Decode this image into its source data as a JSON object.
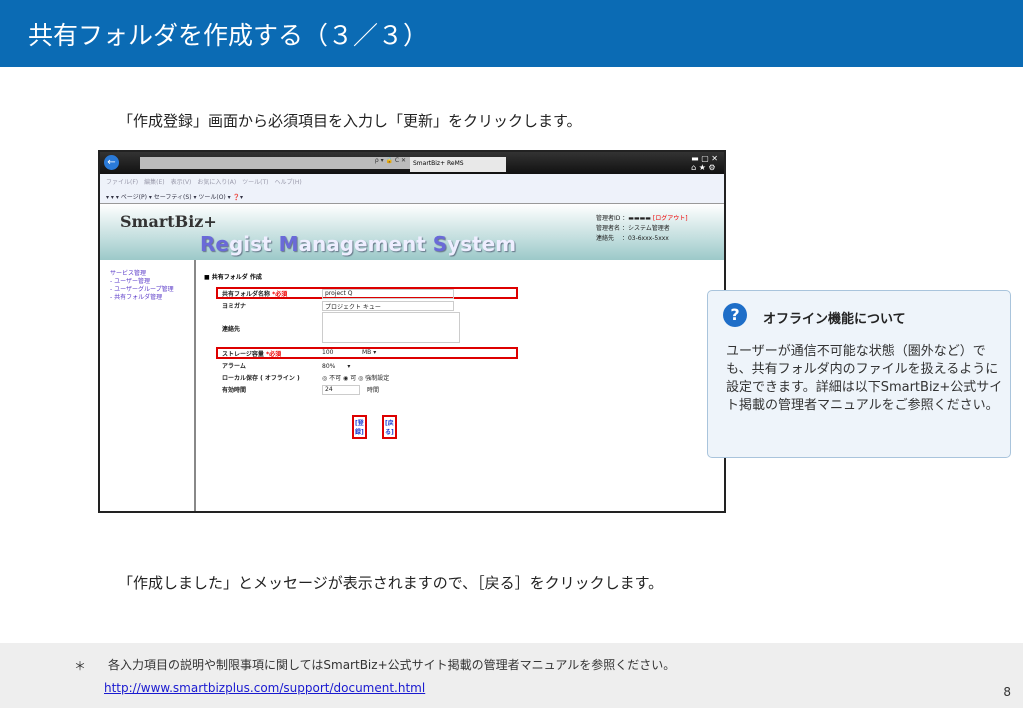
{
  "header": {
    "title": "共有フォルダを作成する（３／３）"
  },
  "instruction1": "「作成登録」画面から必須項目を入力し「更新」をクリックします。",
  "instruction2": "「作成しました」とメッセージが表示されますので、［戻る］をクリックします。",
  "browser": {
    "tab_title": "SmartBiz+ ReMS",
    "address_icons": "ρ ▾ 🔒 C ✕",
    "window_controls": "▬ ▢ ✕",
    "toolbar_icons": "⌂ ★ ⚙",
    "menu": "ファイル(F)　編集(E)　表示(V)　お気に入り(A)　ツール(T)　ヘルプ(H)",
    "command_bar": "▾ ▾ ▾ ページ(P) ▾ セーフティ(S) ▾ ツール(O) ▾ ❓▾",
    "logo": "SmartBiz+",
    "system_name": {
      "r": "Re",
      "r2": "gist ",
      "m": "M",
      "m2": "anagement ",
      "s": "S",
      "s2": "ystem"
    },
    "admin": {
      "id_label": "管理者ID",
      "logout": "[ログアウト]",
      "name_label": "管理者名",
      "name": "：システム管理者",
      "contact_label": "連絡先",
      "contact": "：03-6xxx-5xxx"
    },
    "sidebar": [
      "サービス管理",
      "- ユーザー管理",
      "- ユーザーグループ管理",
      "- 共有フォルダ管理"
    ],
    "form": {
      "heading": "■ 共有フォルダ 作成",
      "required": "*必須",
      "fields": [
        {
          "label": "共有フォルダ名称",
          "value": "project Q"
        },
        {
          "label": "ヨミガナ",
          "value": "プロジェクト キュー"
        },
        {
          "label": "連絡先",
          "value": ""
        },
        {
          "label": "ストレージ容量",
          "value": "100",
          "unit": "MB ▾"
        },
        {
          "label": "アラーム",
          "value": "80%　　▾"
        },
        {
          "label": "ローカル保存 ( オフライン )",
          "value": "◎ 不可 ◉ 可 ◎ 強制設定"
        },
        {
          "label": "有効時間",
          "value": "24",
          "unit": "時間"
        }
      ],
      "register": "[登録]",
      "back": "[戻る]"
    }
  },
  "callout": {
    "icon": "?",
    "title": "オフライン機能について",
    "body": "ユーザーが通信不可能な状態（圏外など）でも、共有フォルダ内のファイルを扱えるように設定できます。詳細は以下SmartBiz+公式サイト掲載の管理者マニュアルをご参照ください。"
  },
  "footer": {
    "mark": "＊",
    "note": "各入力項目の説明や制限事項に関してはSmartBiz+公式サイト掲載の管理者マニュアルを参照ください。",
    "link": "http://www.smartbizplus.com/support/document.html",
    "page": "8"
  }
}
